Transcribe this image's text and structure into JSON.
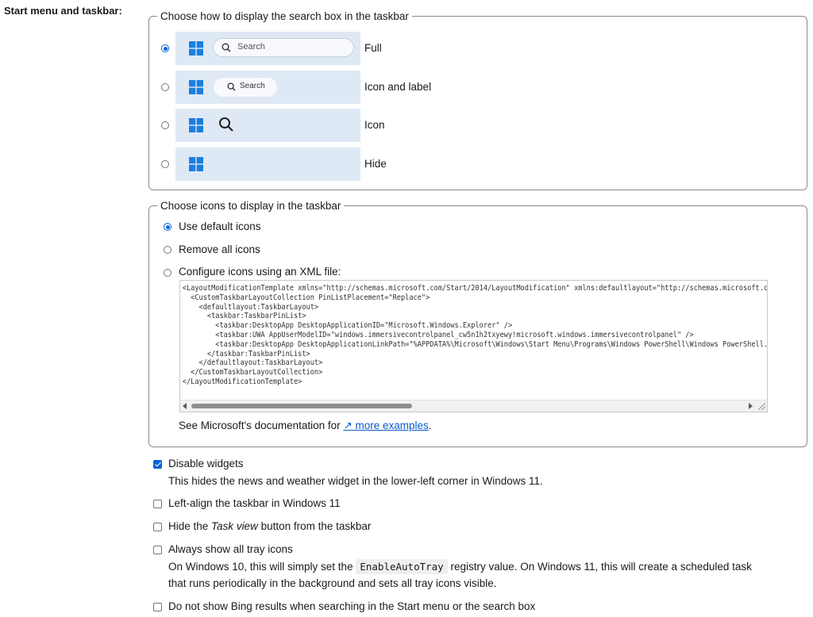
{
  "section_label": "Start menu and taskbar:",
  "search_group": {
    "legend": "Choose how to display the search box in the taskbar",
    "search_placeholder": "Search",
    "options": [
      {
        "label": "Full",
        "checked": true
      },
      {
        "label": "Icon and label",
        "checked": false
      },
      {
        "label": "Icon",
        "checked": false
      },
      {
        "label": "Hide",
        "checked": false
      }
    ]
  },
  "icons_group": {
    "legend": "Choose icons to display in the taskbar",
    "options": [
      {
        "label": "Use default icons",
        "checked": true
      },
      {
        "label": "Remove all icons",
        "checked": false
      },
      {
        "label": "Configure icons using an XML file:",
        "checked": false
      }
    ],
    "xml": "<LayoutModificationTemplate xmlns=\"http://schemas.microsoft.com/Start/2014/LayoutModification\" xmlns:defaultlayout=\"http://schemas.microsoft.com/Start/2014/FullDefaultLayout\"\n  <CustomTaskbarLayoutCollection PinListPlacement=\"Replace\">\n    <defaultlayout:TaskbarLayout>\n      <taskbar:TaskbarPinList>\n        <taskbar:DesktopApp DesktopApplicationID=\"Microsoft.Windows.Explorer\" />\n        <taskbar:UWA AppUserModelID=\"windows.immersivecontrolpanel_cw5n1h2txyewy!microsoft.windows.immersivecontrolpanel\" />\n        <taskbar:DesktopApp DesktopApplicationLinkPath=\"%APPDATA%\\Microsoft\\Windows\\Start Menu\\Programs\\Windows PowerShell\\Windows PowerShell.lnk\" />\n      </taskbar:TaskbarPinList>\n    </defaultlayout:TaskbarLayout>\n  </CustomTaskbarLayoutCollection>\n</LayoutModificationTemplate>",
    "doc_prefix": "See Microsoft's documentation for ",
    "doc_link_icon": "↗",
    "doc_link": "more examples",
    "doc_suffix": "."
  },
  "checkboxes": [
    {
      "label": "Disable widgets",
      "checked": true,
      "desc": "This hides the news and weather widget in the lower-left corner in Windows 11."
    },
    {
      "label": "Left-align the taskbar in Windows 11",
      "checked": false
    },
    {
      "label_pre": "Hide the ",
      "label_em": "Task view",
      "label_post": " button from the taskbar",
      "checked": false
    },
    {
      "label": "Always show all tray icons",
      "checked": false,
      "desc_pre": "On Windows 10, this will simply set the ",
      "desc_code": "EnableAutoTray",
      "desc_post": " registry value. On Windows 11, this will create a scheduled task",
      "desc_line2": "that runs periodically in the background and sets all tray icons visible."
    },
    {
      "label": "Do not show Bing results when searching in the Start menu or the search box",
      "checked": false
    }
  ],
  "colors": {
    "accent": "#0a64d8",
    "preview_bg": "#dfe9f5",
    "link": "#0b57d0"
  }
}
